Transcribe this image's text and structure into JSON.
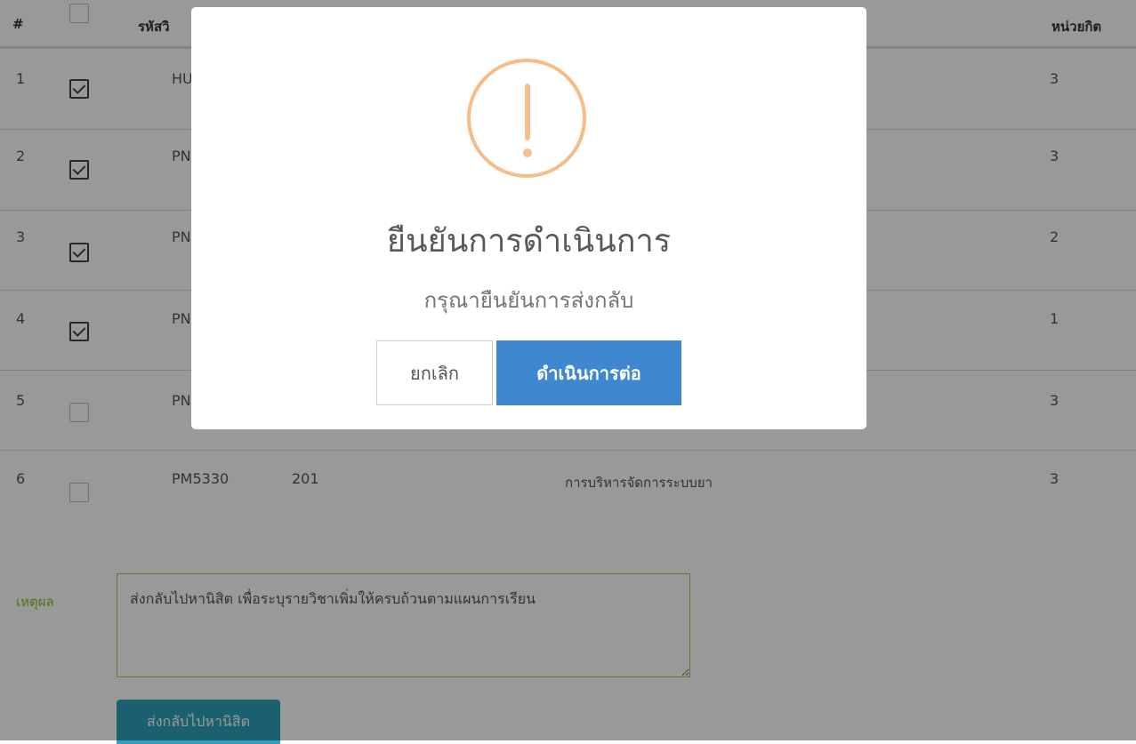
{
  "table": {
    "headers": {
      "num": "#",
      "code": "รหัสวิ",
      "credit": "หน่วยกิต"
    },
    "rows": [
      {
        "num": "1",
        "checked": true,
        "code": "HU",
        "section": "",
        "name": "",
        "credit": "3"
      },
      {
        "num": "2",
        "checked": true,
        "code": "PN",
        "section": "",
        "name": "",
        "credit": "3"
      },
      {
        "num": "3",
        "checked": true,
        "code": "PN",
        "section": "",
        "name": "",
        "credit": "2"
      },
      {
        "num": "4",
        "checked": true,
        "code": "PN",
        "section": "",
        "name": "",
        "credit": "1"
      },
      {
        "num": "5",
        "checked": false,
        "code": "PN",
        "section": "",
        "name": "",
        "credit": "3"
      },
      {
        "num": "6",
        "checked": false,
        "code": "PM5330",
        "section": "201",
        "name": "การบริหารจัดการระบบยา",
        "credit": "3"
      }
    ]
  },
  "reason": {
    "label": "เหตุผล",
    "value": "ส่งกลับไปหานิสิต เพื่อระบุรายวิชาเพิ่มให้ครบถ้วนตามแผนการเรียน"
  },
  "submit_label": "ส่งกลับไปหานิสิต",
  "dialog": {
    "icon": "exclamation-warning-icon",
    "icon_color": "#f8bb86",
    "title": "ยืนยันการดำเนินการ",
    "text": "กรุณายืนยันการส่งกลับ",
    "cancel_label": "ยกเลิก",
    "confirm_label": "ดำเนินการต่อ",
    "confirm_color": "#3f88d0"
  }
}
